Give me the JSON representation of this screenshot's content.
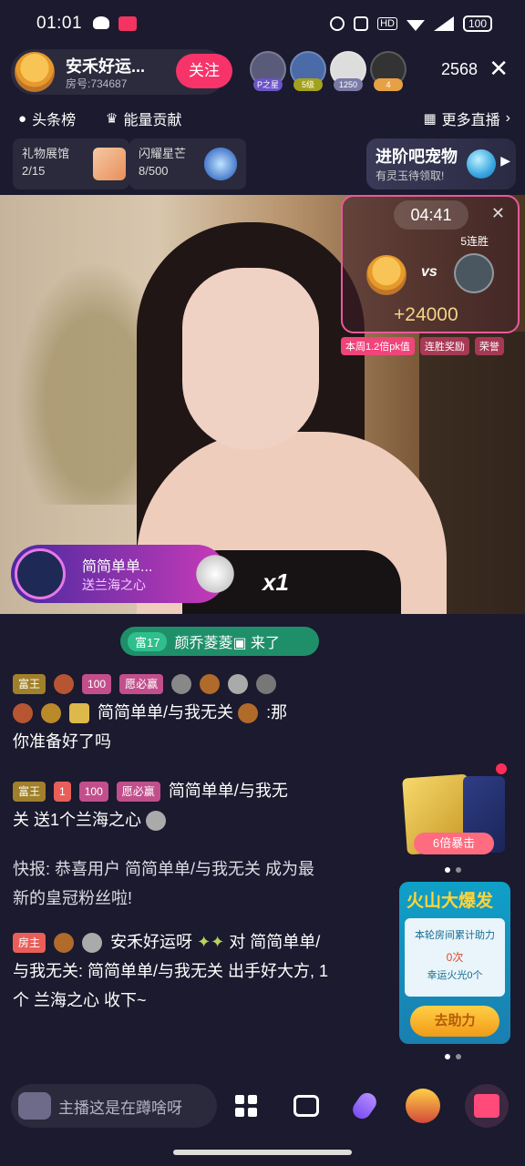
{
  "status_bar": {
    "time": "01:01",
    "battery": "100",
    "hd_label": "HD"
  },
  "header": {
    "host_name": "安禾好运...",
    "room_number": "房号:734687",
    "follow_label": "关注",
    "viewers": [
      {
        "badge": "P之星"
      },
      {
        "badge": "5级"
      },
      {
        "badge": "1250"
      },
      {
        "badge": "4"
      }
    ],
    "viewer_count": "2568",
    "close_icon": "close-icon"
  },
  "rank_row": {
    "headline_label": "头条榜",
    "energy_label": "能量贡献",
    "more_live_label": "更多直播"
  },
  "gift_row": {
    "gallery_label": "礼物展馆",
    "gallery_count": "2/15",
    "star_label": "闪耀星芒",
    "star_count": "8/500",
    "pet_title": "进阶吧宠物",
    "pet_subtitle": "有灵玉待领取!"
  },
  "pk": {
    "timer": "04:41",
    "vs_label": "vs",
    "streak_label": "5连胜",
    "score": "+24000",
    "tags": [
      "本周1.2倍pk值",
      "连胜奖励",
      "荣誉"
    ]
  },
  "gift_toast": {
    "sender": "简简单单...",
    "gift_text": "送兰海之心",
    "combo": "x1"
  },
  "entry_notice": {
    "level": "富17",
    "text": "颜乔菱菱▣ 来了"
  },
  "chat": [
    {
      "badges": [
        "富王",
        "100",
        "愿必赢"
      ],
      "line2_prefix": "简简单单/与我无关",
      "line2_suffix": ":那",
      "line3": "你准备好了吗"
    },
    {
      "badges": [
        "富王",
        "1",
        "100",
        "愿必赢"
      ],
      "line1_text": "简简单单/与我无",
      "line2_text": "关 送1个兰海之心"
    },
    {
      "line1": "快报: 恭喜用户 简简单单/与我无关 成为最",
      "line2": "新的皇冠粉丝啦!"
    },
    {
      "badge": "房主",
      "line1_name": "安禾好运呀",
      "line1_mid": "对",
      "line1_target": "简简单单/",
      "line2": "与我无关: 简简单单/与我无关 出手好大方, 1",
      "line3": "个 兰海之心 收下~"
    }
  ],
  "promo": {
    "card_label": "6倍暴击",
    "volcano_title": "火山大爆发",
    "volcano_line1": "本轮房间累计助力",
    "volcano_line2": "0次",
    "volcano_line3": "幸运火光0个",
    "volcano_button": "去助力"
  },
  "bottom_bar": {
    "input_placeholder": "主播这是在蹲啥呀"
  }
}
